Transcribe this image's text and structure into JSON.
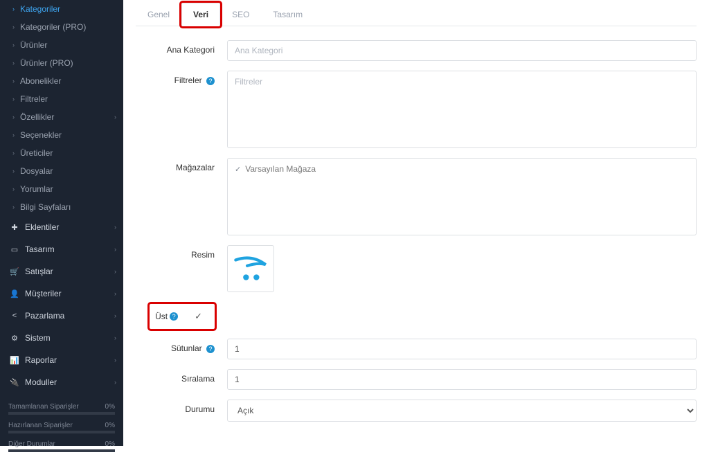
{
  "sidebar": {
    "sub_items": [
      {
        "label": "Kategoriler",
        "active": true
      },
      {
        "label": "Kategoriler (PRO)"
      },
      {
        "label": "Ürünler"
      },
      {
        "label": "Ürünler (PRO)"
      },
      {
        "label": "Abonelikler"
      },
      {
        "label": "Filtreler"
      },
      {
        "label": "Özellikler",
        "expand": true
      },
      {
        "label": "Seçenekler"
      },
      {
        "label": "Üreticiler"
      },
      {
        "label": "Dosyalar"
      },
      {
        "label": "Yorumlar"
      },
      {
        "label": "Bilgi Sayfaları"
      }
    ],
    "top_items": [
      {
        "icon": "puzzle-icon",
        "label": "Eklentiler"
      },
      {
        "icon": "desktop-icon",
        "label": "Tasarım"
      },
      {
        "icon": "cart-icon",
        "label": "Satışlar"
      },
      {
        "icon": "user-icon",
        "label": "Müşteriler"
      },
      {
        "icon": "share-icon",
        "label": "Pazarlama"
      },
      {
        "icon": "gear-icon",
        "label": "Sistem"
      },
      {
        "icon": "bar-chart-icon",
        "label": "Raporlar"
      },
      {
        "icon": "plug-icon",
        "label": "Moduller"
      }
    ],
    "stats": [
      {
        "label": "Tamamlanan Siparişler",
        "value": "0%"
      },
      {
        "label": "Hazırlanan Siparişler",
        "value": "0%"
      },
      {
        "label": "Diğer Durumlar",
        "value": "0%"
      }
    ]
  },
  "tabs": [
    {
      "label": "Genel"
    },
    {
      "label": "Veri",
      "active": true,
      "highlight": true
    },
    {
      "label": "SEO"
    },
    {
      "label": "Tasarım"
    }
  ],
  "form": {
    "ana_kategori": {
      "label": "Ana Kategori",
      "placeholder": "Ana Kategori",
      "value": ""
    },
    "filtreler": {
      "label": "Filtreler",
      "placeholder": "Filtreler"
    },
    "magazalar": {
      "label": "Mağazalar",
      "store": "Varsayılan Mağaza"
    },
    "resim": {
      "label": "Resim"
    },
    "ust": {
      "label": "Üst",
      "checked": true,
      "highlight": true
    },
    "sutunlar": {
      "label": "Sütunlar",
      "value": "1"
    },
    "siralama": {
      "label": "Sıralama",
      "value": "1"
    },
    "durumu": {
      "label": "Durumu",
      "value": "Açık"
    }
  }
}
